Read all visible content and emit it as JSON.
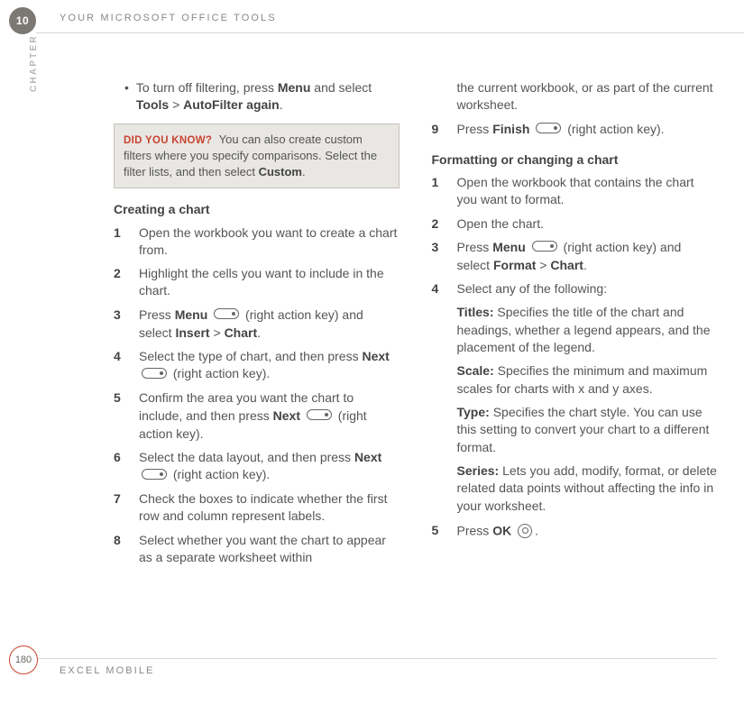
{
  "header": {
    "chapter_number": "10",
    "chapter_label": "CHAPTER",
    "title": "YOUR MICROSOFT OFFICE TOOLS"
  },
  "left": {
    "filter_bullet": {
      "pre": "To turn off filtering, press ",
      "menu": "Menu",
      "mid": " and select ",
      "tools": "Tools",
      "gt": " > ",
      "autofilter": "AutoFilter again",
      "end": "."
    },
    "callout": {
      "tag": "DID YOU KNOW?",
      "body_pre": "You can also create custom filters where you specify comparisons. Select the filter lists, and then select ",
      "custom": "Custom",
      "body_post": "."
    },
    "section_title": "Creating a chart",
    "steps": [
      {
        "n": "1",
        "text": "Open the workbook you want to create a chart from."
      },
      {
        "n": "2",
        "text": "Highlight the cells you want to include in the chart."
      },
      {
        "n": "3",
        "pre": "Press ",
        "b1": "Menu",
        "key": true,
        "mid": " (right action key) and select ",
        "b2": "Insert",
        "gt": " > ",
        "b3": "Chart",
        "post": "."
      },
      {
        "n": "4",
        "pre": "Select the type of chart, and then press ",
        "b1": "Next",
        "key": true,
        "post": " (right action key)."
      },
      {
        "n": "5",
        "pre": "Confirm the area you want the chart to include, and then press ",
        "b1": "Next",
        "key": true,
        "post": " (right action key)."
      },
      {
        "n": "6",
        "pre": "Select the data layout, and then press ",
        "b1": "Next",
        "key": true,
        "post": " (right action key)."
      },
      {
        "n": "7",
        "text": "Check the boxes to indicate whether the first row and column represent labels."
      },
      {
        "n": "8",
        "text": "Select whether you want the chart to appear as a separate worksheet within"
      }
    ]
  },
  "right": {
    "continuation": "the current workbook, or as part of the current worksheet.",
    "step9": {
      "n": "9",
      "pre": "Press ",
      "b1": "Finish",
      "key": true,
      "post": " (right action key)."
    },
    "section_title": "Formatting or changing a chart",
    "steps": [
      {
        "n": "1",
        "text": "Open the workbook that contains the chart you want to format."
      },
      {
        "n": "2",
        "text": "Open the chart."
      },
      {
        "n": "3",
        "pre": "Press ",
        "b1": "Menu",
        "key": true,
        "mid": " (right action key) and select ",
        "b2": "Format",
        "gt": " > ",
        "b3": "Chart",
        "post": "."
      },
      {
        "n": "4",
        "text": "Select any of the following:"
      }
    ],
    "subs": [
      {
        "label": "Titles:",
        "text": " Specifies the title of the chart and headings, whether a legend appears, and the placement of the legend."
      },
      {
        "label": "Scale:",
        "text": " Specifies the minimum and maximum scales for charts with x and y axes."
      },
      {
        "label": "Type:",
        "text": " Specifies the chart style. You can use this setting to convert your chart to a different format."
      },
      {
        "label": "Series:",
        "text": " Lets you add, modify, format, or delete related data points without affecting the info in your worksheet."
      }
    ],
    "step5": {
      "n": "5",
      "pre": "Press ",
      "b1": "OK",
      "round": true,
      "post": "."
    }
  },
  "footer": {
    "page": "180",
    "title": "EXCEL MOBILE"
  }
}
